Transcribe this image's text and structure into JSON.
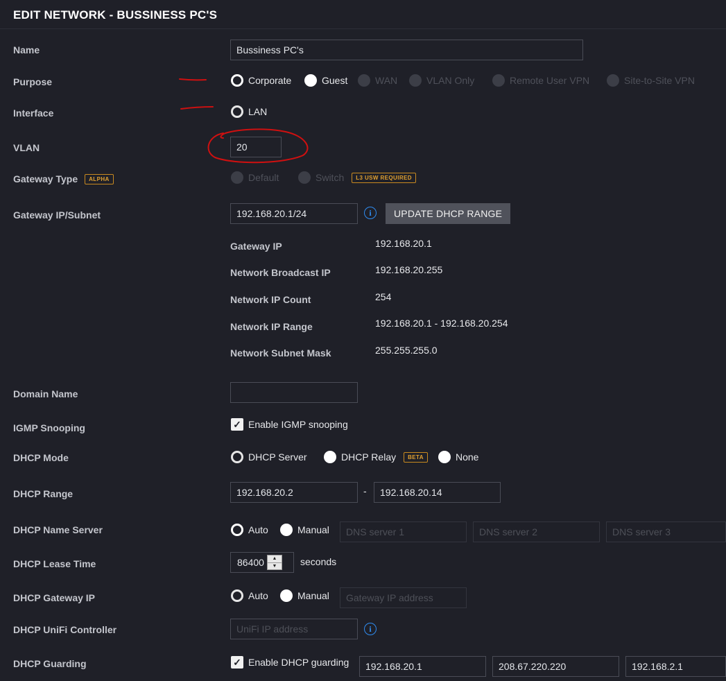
{
  "header": {
    "title": "EDIT NETWORK - BUSSINESS PC'S"
  },
  "labels": {
    "name": "Name",
    "purpose": "Purpose",
    "interface": "Interface",
    "vlan": "VLAN",
    "gateway_type": "Gateway Type",
    "gateway_ip_subnet": "Gateway IP/Subnet",
    "domain_name": "Domain Name",
    "igmp_snooping": "IGMP Snooping",
    "dhcp_mode": "DHCP Mode",
    "dhcp_range": "DHCP Range",
    "dhcp_name_server": "DHCP Name Server",
    "dhcp_lease_time": "DHCP Lease Time",
    "dhcp_gateway_ip": "DHCP Gateway IP",
    "dhcp_unifi_controller": "DHCP UniFi Controller",
    "dhcp_guarding": "DHCP Guarding"
  },
  "name_value": "Bussiness PC's",
  "purpose_options": [
    "Corporate",
    "Guest",
    "WAN",
    "VLAN Only",
    "Remote User VPN",
    "Site-to-Site VPN"
  ],
  "interface_option": "LAN",
  "vlan_value": "20",
  "gateway_type": {
    "badge": "ALPHA",
    "options": [
      "Default",
      "Switch"
    ],
    "switch_badge": "L3 USW REQUIRED"
  },
  "gateway": {
    "value": "192.168.20.1/24",
    "update_button": "UPDATE DHCP RANGE",
    "details": {
      "gateway_ip_label": "Gateway IP",
      "gateway_ip": "192.168.20.1",
      "broadcast_label": "Network Broadcast IP",
      "broadcast": "192.168.20.255",
      "count_label": "Network IP Count",
      "count": "254",
      "range_label": "Network IP Range",
      "range": "192.168.20.1 - 192.168.20.254",
      "mask_label": "Network Subnet Mask",
      "mask": "255.255.255.0"
    }
  },
  "domain_name_value": "",
  "igmp": {
    "checked": true,
    "label": "Enable IGMP snooping"
  },
  "dhcp_mode": {
    "options": [
      "DHCP Server",
      "DHCP Relay",
      "None"
    ],
    "relay_badge": "BETA"
  },
  "dhcp_range": {
    "start": "192.168.20.2",
    "separator": "-",
    "end": "192.168.20.14"
  },
  "dhcp_name_server": {
    "auto": "Auto",
    "manual": "Manual",
    "placeholders": [
      "DNS server 1",
      "DNS server 2",
      "DNS server 3"
    ]
  },
  "lease": {
    "value": "86400",
    "unit": "seconds"
  },
  "dhcp_gateway": {
    "auto": "Auto",
    "manual": "Manual",
    "placeholder": "Gateway IP address"
  },
  "controller": {
    "placeholder": "UniFi IP address"
  },
  "guarding": {
    "checked": true,
    "label": "Enable DHCP guarding",
    "servers": [
      "192.168.20.1",
      "208.67.220.220",
      "192.168.2.1"
    ]
  },
  "colors": {
    "background": "#1f2028",
    "accent_blue": "#2f8cf0",
    "badge_orange": "#e0a030",
    "annotation_red": "#d01010"
  }
}
